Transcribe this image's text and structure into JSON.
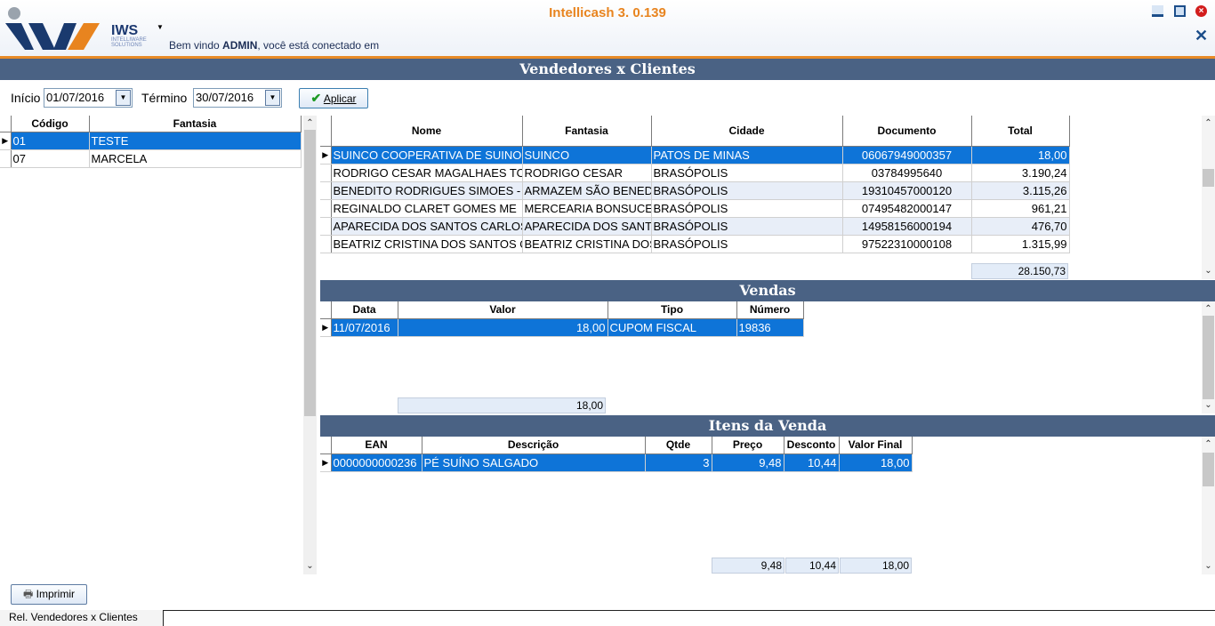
{
  "app": {
    "title": "Intellicash 3. 0.139",
    "welcome_prefix": "Bem vindo ",
    "welcome_user": "ADMIN",
    "welcome_suffix": ", você está conectado em",
    "logo_text": "IWS",
    "logo_sub": "INTELLIWARE SOLUTIONS"
  },
  "page": {
    "title": "Vendedores x Clientes"
  },
  "filters": {
    "inicio_label": "Início",
    "inicio_value": "01/07/2016",
    "termino_label": "Término",
    "termino_value": "30/07/2016",
    "apply_label": "Aplicar"
  },
  "vendedores": {
    "headers": [
      "Código",
      "Fantasia"
    ],
    "rows": [
      [
        "01",
        "TESTE"
      ],
      [
        "07",
        "MARCELA"
      ]
    ]
  },
  "clientes": {
    "headers": [
      "Nome",
      "Fantasia",
      "Cidade",
      "Documento",
      "Total"
    ],
    "rows": [
      [
        "SUINCO COOPERATIVA DE SUINOC",
        "SUINCO",
        "PATOS DE MINAS",
        "06067949000357",
        "18,00"
      ],
      [
        "RODRIGO CESAR MAGALHAES TO",
        "RODRIGO CESAR",
        "BRASÓPOLIS",
        "03784995640",
        "3.190,24"
      ],
      [
        "BENEDITO RODRIGUES SIMOES -",
        "ARMAZEM SÃO BENED",
        "BRASÓPOLIS",
        "19310457000120",
        "3.115,26"
      ],
      [
        "REGINALDO CLARET GOMES ME",
        "MERCEARIA BONSUCE",
        "BRASÓPOLIS",
        "07495482000147",
        "961,21"
      ],
      [
        "APARECIDA DOS SANTOS CARLOS",
        "APARECIDA DOS SANT",
        "BRASÓPOLIS",
        "14958156000194",
        "476,70"
      ],
      [
        "BEATRIZ CRISTINA DOS SANTOS O",
        "BEATRIZ CRISTINA DOS",
        "BRASÓPOLIS",
        "97522310000108",
        "1.315,99"
      ]
    ],
    "total": "28.150,73"
  },
  "vendas": {
    "title": "Vendas",
    "headers": [
      "Data",
      "Valor",
      "Tipo",
      "Número"
    ],
    "rows": [
      [
        "11/07/2016",
        "18,00",
        "CUPOM FISCAL",
        "19836"
      ]
    ],
    "total": "18,00"
  },
  "itens": {
    "title": "Itens da Venda",
    "headers": [
      "EAN",
      "Descrição",
      "Qtde",
      "Preço",
      "Desconto",
      "Valor Final"
    ],
    "rows": [
      [
        "0000000000236",
        "PÉ SUÍNO SALGADO",
        "3",
        "9,48",
        "10,44",
        "18,00"
      ]
    ],
    "totals": {
      "preco": "9,48",
      "desconto": "10,44",
      "valor_final": "18,00"
    }
  },
  "footer": {
    "print_label": "Imprimir",
    "tab_label": "Rel. Vendedores x Clientes"
  }
}
